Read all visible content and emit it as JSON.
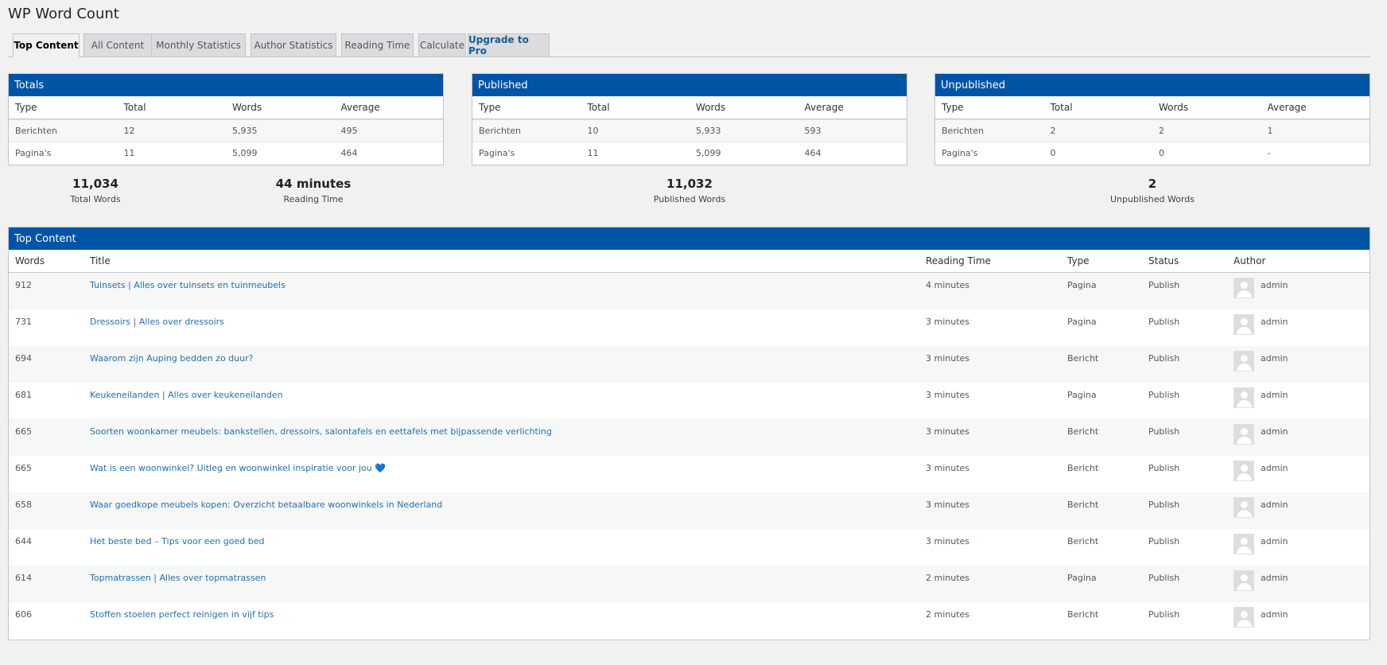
{
  "page_title": "WP Word Count",
  "tabs": [
    "Top Content",
    "All Content",
    "Monthly Statistics",
    "Author Statistics",
    "Reading Time",
    "Calculate",
    "Upgrade to Pro"
  ],
  "stat_columns": [
    "Type",
    "Total",
    "Words",
    "Average"
  ],
  "totals": {
    "title": "Totals",
    "rows": [
      [
        "Berichten",
        "12",
        "5,935",
        "495"
      ],
      [
        "Pagina's",
        "11",
        "5,099",
        "464"
      ]
    ]
  },
  "published": {
    "title": "Published",
    "rows": [
      [
        "Berichten",
        "10",
        "5,933",
        "593"
      ],
      [
        "Pagina's",
        "11",
        "5,099",
        "464"
      ]
    ]
  },
  "unpublished": {
    "title": "Unpublished",
    "rows": [
      [
        "Berichten",
        "2",
        "2",
        "1"
      ],
      [
        "Pagina's",
        "0",
        "0",
        "-"
      ]
    ]
  },
  "summaries": {
    "total_words": {
      "value": "11,034",
      "label": "Total Words"
    },
    "reading_time": {
      "value": "44 minutes",
      "label": "Reading Time"
    },
    "published_words": {
      "value": "11,032",
      "label": "Published Words"
    },
    "unpublished_words": {
      "value": "2",
      "label": "Unpublished Words"
    }
  },
  "top_content": {
    "title": "Top Content",
    "columns": [
      "Words",
      "Title",
      "Reading Time",
      "Type",
      "Status",
      "Author"
    ],
    "rows": [
      {
        "words": "912",
        "title": "Tuinsets | Alles over tuinsets en tuinmeubels",
        "reading": "4 minutes",
        "type": "Pagina",
        "status": "Publish",
        "author": "admin"
      },
      {
        "words": "731",
        "title": "Dressoirs | Alles over dressoirs",
        "reading": "3 minutes",
        "type": "Pagina",
        "status": "Publish",
        "author": "admin"
      },
      {
        "words": "694",
        "title": "Waarom zijn Auping bedden zo duur?",
        "reading": "3 minutes",
        "type": "Bericht",
        "status": "Publish",
        "author": "admin"
      },
      {
        "words": "681",
        "title": "Keukeneilanden | Alles over keukeneilanden",
        "reading": "3 minutes",
        "type": "Pagina",
        "status": "Publish",
        "author": "admin"
      },
      {
        "words": "665",
        "title": "Soorten woonkamer meubels: bankstellen, dressoirs, salontafels en eettafels met bijpassende verlichting",
        "reading": "3 minutes",
        "type": "Bericht",
        "status": "Publish",
        "author": "admin"
      },
      {
        "words": "665",
        "title": "Wat is een woonwinkel? Uitleg en woonwinkel inspiratie voor jou 💙",
        "reading": "3 minutes",
        "type": "Bericht",
        "status": "Publish",
        "author": "admin"
      },
      {
        "words": "658",
        "title": "Waar goedkope meubels kopen: Overzicht betaalbare woonwinkels in Nederland",
        "reading": "3 minutes",
        "type": "Bericht",
        "status": "Publish",
        "author": "admin"
      },
      {
        "words": "644",
        "title": "Het beste bed – Tips voor een goed bed",
        "reading": "3 minutes",
        "type": "Bericht",
        "status": "Publish",
        "author": "admin"
      },
      {
        "words": "614",
        "title": "Topmatrassen | Alles over topmatrassen",
        "reading": "2 minutes",
        "type": "Pagina",
        "status": "Publish",
        "author": "admin"
      },
      {
        "words": "606",
        "title": "Stoffen stoelen perfect reinigen in vijf tips",
        "reading": "2 minutes",
        "type": "Bericht",
        "status": "Publish",
        "author": "admin"
      }
    ]
  }
}
